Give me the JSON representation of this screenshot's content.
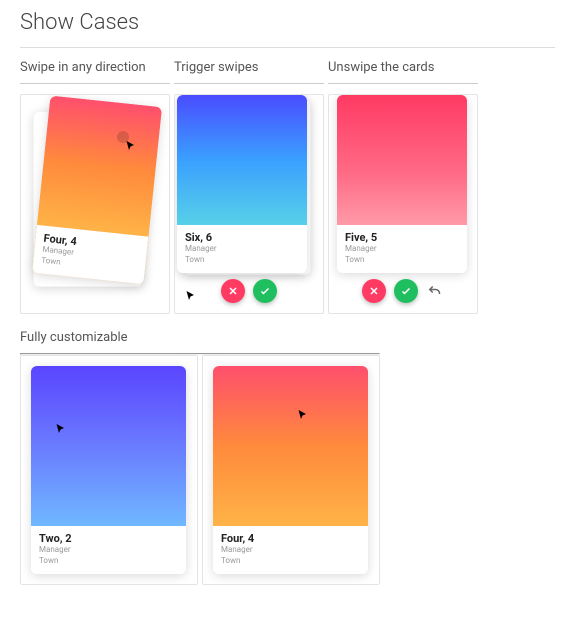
{
  "page_title": "Show Cases",
  "columns": {
    "swipe": {
      "heading": "Swipe in any direction",
      "card": {
        "name": "Four, 4",
        "role": "Manager",
        "town": "Town"
      }
    },
    "trigger": {
      "heading": "Trigger swipes",
      "card": {
        "name": "Six, 6",
        "role": "Manager",
        "town": "Town"
      }
    },
    "unswipe": {
      "heading": "Unswipe the cards",
      "card": {
        "name": "Five, 5",
        "role": "Manager",
        "town": "Town"
      }
    }
  },
  "fully": {
    "heading": "Fully customizable",
    "left_card": {
      "name": "Two, 2",
      "role": "Manager",
      "town": "Town"
    },
    "right_card": {
      "name": "Four, 4",
      "role": "Manager",
      "town": "Town"
    }
  }
}
